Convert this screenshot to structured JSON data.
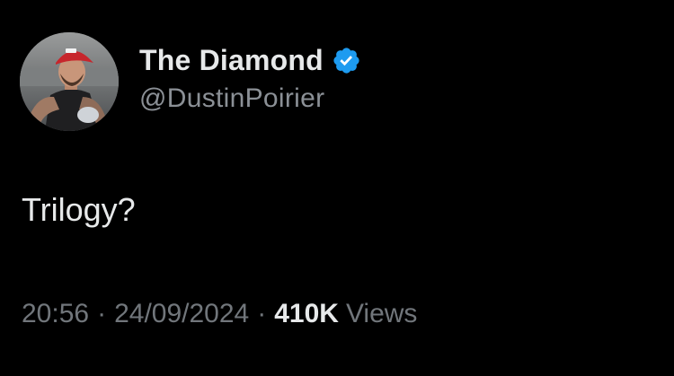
{
  "author": {
    "display_name": "The Diamond",
    "handle": "@DustinPoirier",
    "verified": true,
    "avatar_icon": "profile-photo",
    "verified_icon": "verified-badge-icon"
  },
  "tweet": {
    "text": "Trilogy?"
  },
  "meta": {
    "time": "20:56",
    "separator": "·",
    "date": "24/09/2024",
    "views_count": "410K",
    "views_label": "Views"
  },
  "colors": {
    "background": "#000000",
    "primary_text": "#e7e9ea",
    "secondary_text": "#71767b",
    "verified_blue": "#1d9bf0"
  }
}
